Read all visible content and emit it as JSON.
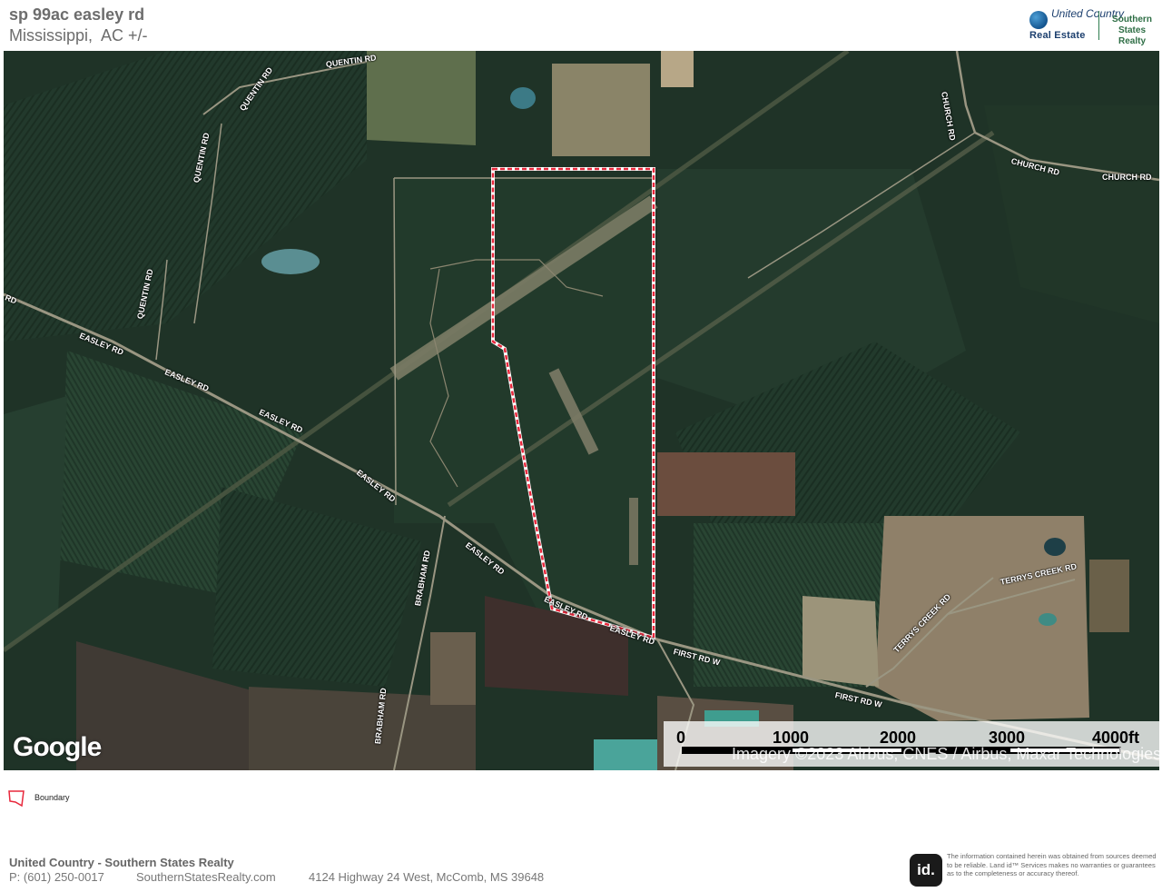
{
  "header": {
    "title": "sp 99ac easley rd",
    "subtitle": "Mississippi,  AC +/-"
  },
  "logo": {
    "brand_top": "United Country",
    "brand_bottom": "Real Estate",
    "partner": "Southern States Realty"
  },
  "map": {
    "road_labels": [
      "QUENTIN RD",
      "QUENTIN RD",
      "QUENTIN RD",
      "QUENTIN RD",
      "CHURCH RD",
      "CHURCH RD",
      "CHURCH RD",
      "EASLEY RD",
      "EASLEY RD",
      "EASLEY RD",
      "EASLEY RD",
      "EASLEY RD",
      "EASLEY RD",
      "EASLEY RD",
      "BRABHAM RD",
      "BRABHAM RD",
      "FIRST RD W",
      "FIRST RD W",
      "TERRYS CREEK RD",
      "TERRYS CREEK RD",
      "RD"
    ],
    "provider_logo": "Google",
    "attribution": "Imagery ©2023 Airbus, CNES / Airbus, Maxar Technologies",
    "scale": {
      "labels": [
        "0",
        "1000",
        "2000",
        "3000",
        "4000ft"
      ]
    },
    "colors": {
      "boundary": "#e8283c",
      "forest": "#1f3327",
      "field": "#8d7a63"
    }
  },
  "legend": {
    "boundary_label": "Boundary"
  },
  "footer": {
    "company": "United Country - Southern States Realty",
    "phone": "P: (601) 250-0017",
    "website": "SouthernStatesRealty.com",
    "address": "4124 Highway 24 West, McComb, MS 39648",
    "id_logo": "id.",
    "disclaimer": "The information contained herein was obtained from sources deemed to be reliable. Land id™ Services makes no warranties or guarantees as to the completeness or accuracy thereof."
  }
}
